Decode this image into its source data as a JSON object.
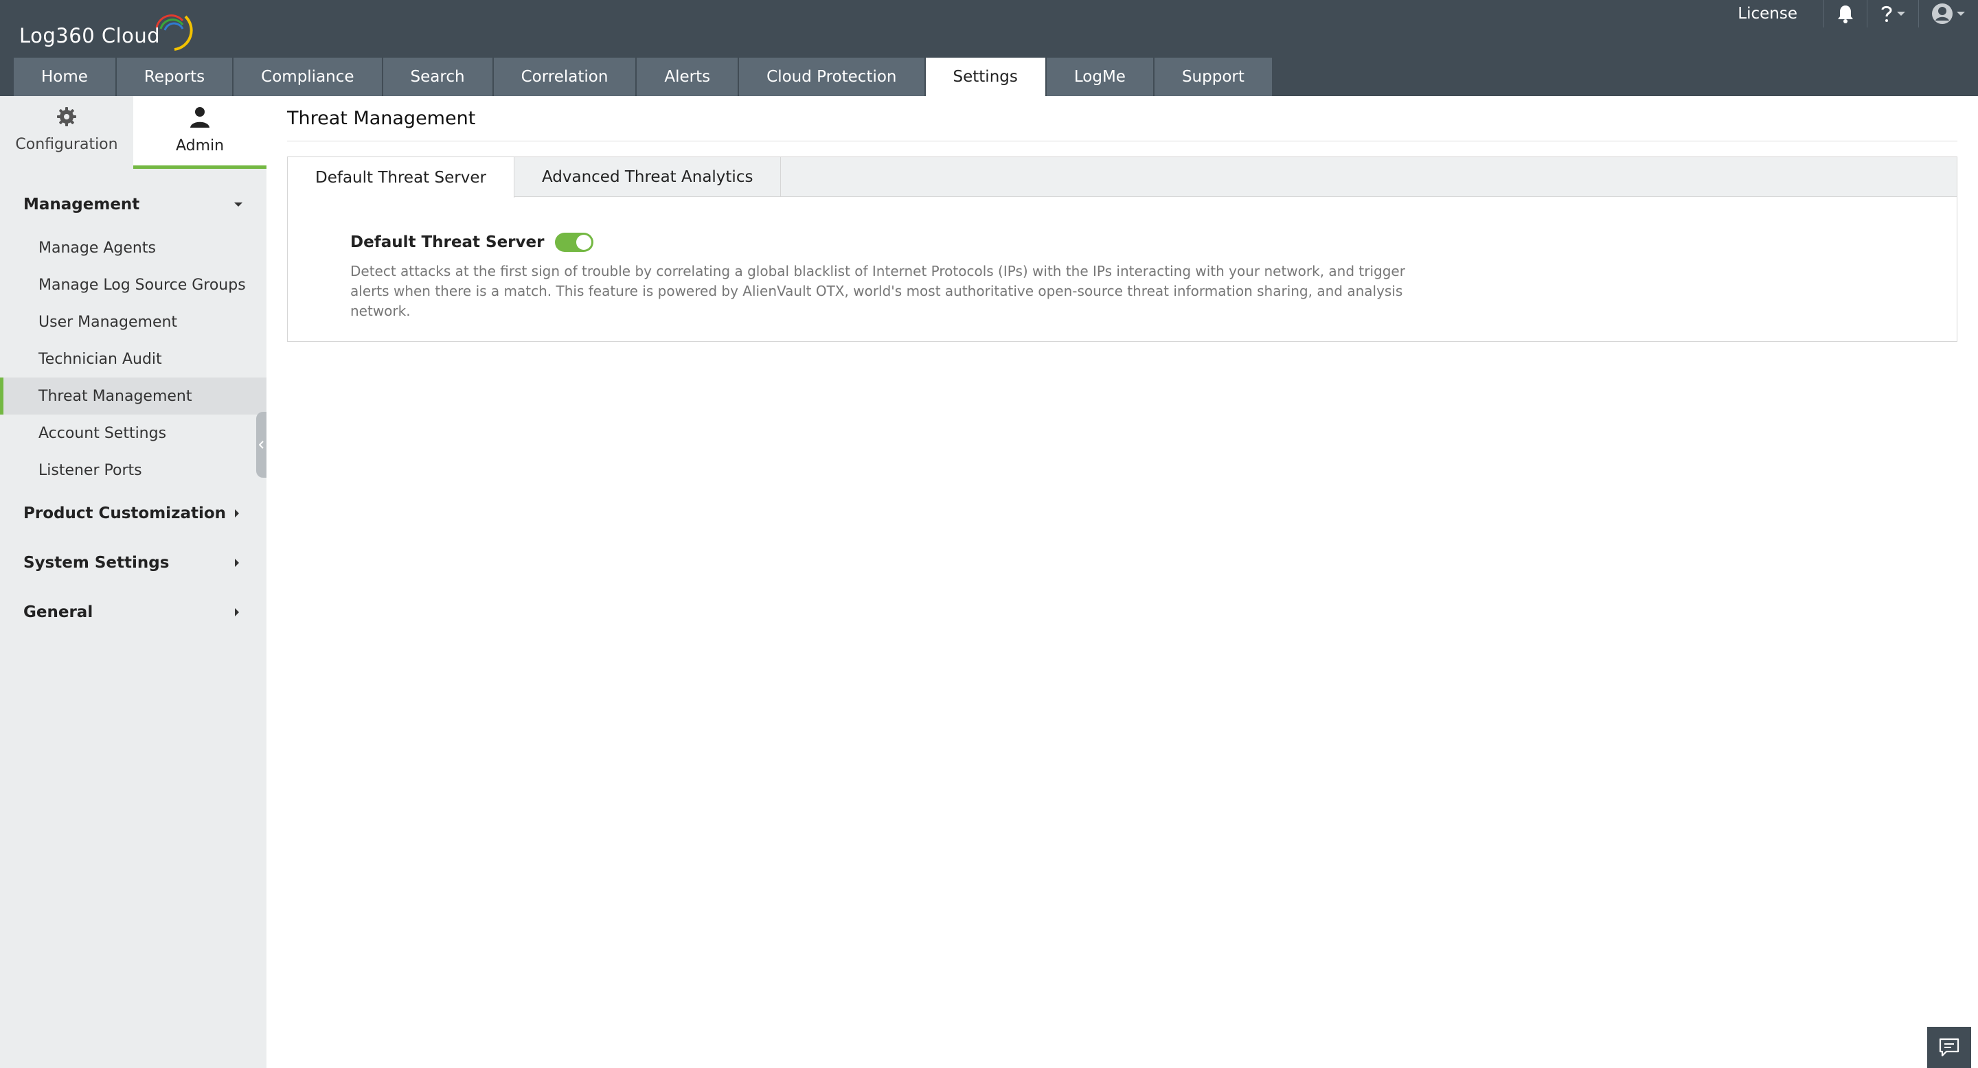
{
  "app": {
    "logo_text": "Log360  Cloud",
    "license_label": "License"
  },
  "nav": {
    "tabs": [
      {
        "label": "Home"
      },
      {
        "label": "Reports"
      },
      {
        "label": "Compliance"
      },
      {
        "label": "Search"
      },
      {
        "label": "Correlation"
      },
      {
        "label": "Alerts"
      },
      {
        "label": "Cloud Protection"
      },
      {
        "label": "Settings",
        "active": true
      },
      {
        "label": "LogMe"
      },
      {
        "label": "Support"
      }
    ]
  },
  "sidebar": {
    "switch": {
      "configuration_label": "Configuration",
      "admin_label": "Admin",
      "active": "Admin"
    },
    "sections": [
      {
        "label": "Management",
        "expanded": true,
        "items": [
          {
            "label": "Manage Agents"
          },
          {
            "label": "Manage Log Source Groups"
          },
          {
            "label": "User Management"
          },
          {
            "label": "Technician Audit"
          },
          {
            "label": "Threat Management",
            "active": true
          },
          {
            "label": "Account Settings"
          },
          {
            "label": "Listener Ports"
          }
        ]
      },
      {
        "label": "Product Customization",
        "expanded": false
      },
      {
        "label": "System Settings",
        "expanded": false
      },
      {
        "label": "General",
        "expanded": false
      }
    ]
  },
  "main": {
    "title": "Threat Management",
    "subtabs": [
      {
        "label": "Default Threat Server",
        "active": true
      },
      {
        "label": "Advanced Threat Analytics"
      }
    ],
    "setting": {
      "label": "Default Threat Server",
      "enabled": true,
      "description": "Detect attacks at the first sign of trouble by correlating a global blacklist of Internet Protocols (IPs) with the IPs interacting with your network, and trigger alerts when there is a match. This feature is powered by AlienVault OTX, world's most authoritative open-source threat information sharing, and analysis network."
    }
  },
  "colors": {
    "header_bg": "#414c55",
    "tab_bg": "#5d6a75",
    "accent_green": "#74b843",
    "sidebar_bg": "#ebedee"
  },
  "icons": [
    "bell-icon",
    "help-icon",
    "user-avatar-icon",
    "gear-icon",
    "admin-user-icon",
    "caret-down-icon",
    "caret-right-icon",
    "chat-icon"
  ]
}
